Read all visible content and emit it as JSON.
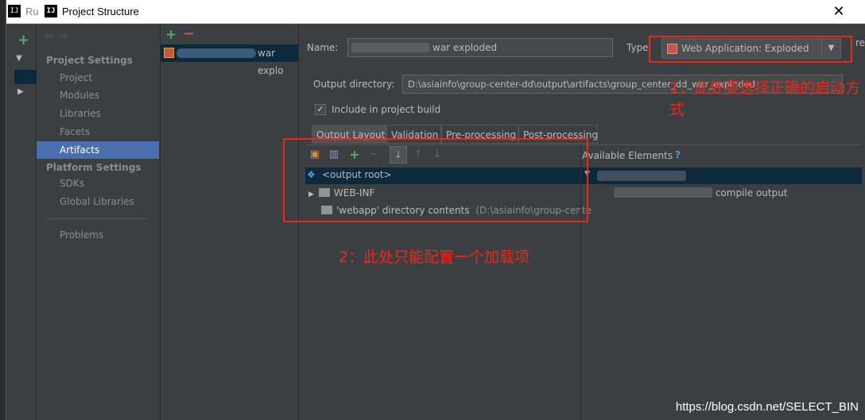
{
  "window": {
    "title": "Project Structure",
    "background_title": "Ru",
    "app_icon": "IJ",
    "close_icon": "✕"
  },
  "outer_panel": {
    "add_icon": "+"
  },
  "nav": {
    "project_settings_header": "Project Settings",
    "project_settings_items": [
      "Project",
      "Modules",
      "Libraries",
      "Facets",
      "Artifacts"
    ],
    "selected": "Artifacts",
    "platform_settings_header": "Platform Settings",
    "platform_settings_items": [
      "SDKs",
      "Global Libraries"
    ],
    "problems": "Problems"
  },
  "artifacts_list": {
    "add_icon": "+",
    "remove_icon": "−",
    "entry_suffix": "war explo"
  },
  "form": {
    "name_label": "Name:",
    "name_value_suffix": "war exploded",
    "type_label": "Type:",
    "type_value": "Web Application: Exploded",
    "type_dropdown_icon": "▼",
    "output_dir_label": "Output directory:",
    "output_dir_value": "D:\\asiainfo\\group-center-dd\\output\\artifacts\\group_center_dd_war_exploded",
    "include_label": "Include in project build",
    "include_checked": true
  },
  "tabs": [
    "Output Layout",
    "Validation",
    "Pre-processing",
    "Post-processing"
  ],
  "active_tab": "Output Layout",
  "layout_tree": {
    "root": "<output root>",
    "items": [
      {
        "label": "WEB-INF",
        "expandable": true
      },
      {
        "label": "'webapp' directory contents",
        "hint": "(D:\\asiainfo\\group-cente"
      }
    ]
  },
  "available": {
    "header": "Available Elements",
    "help_icon": "?",
    "item_suffix": "compile output"
  },
  "annotations": {
    "note1": "1：此处要选择正确的启动方式",
    "note2": "2：此处只能配置一个加载项",
    "color": "#e8281d"
  },
  "watermark": "https://blog.csdn.net/SELECT_BIN",
  "edge_fragment": "re"
}
